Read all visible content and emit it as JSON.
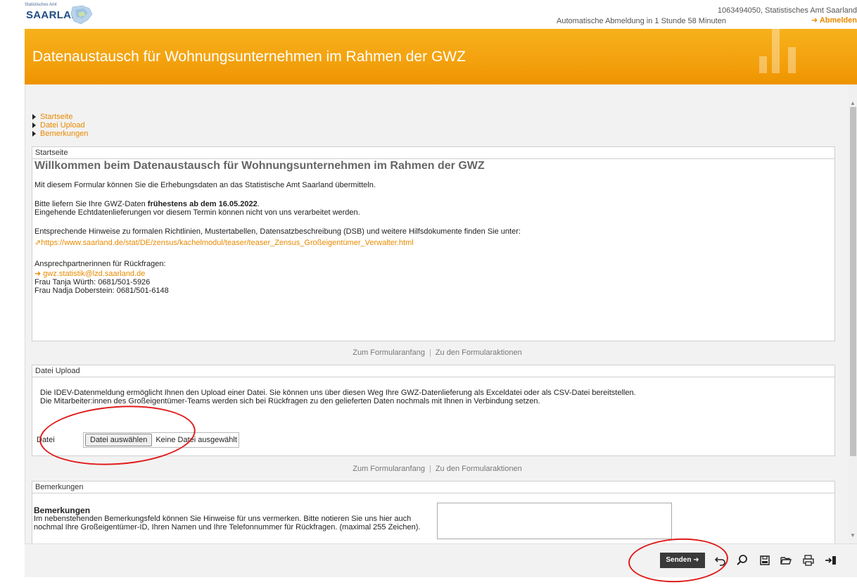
{
  "header": {
    "logo_small": "Statistisches Amt",
    "logo_text": "SAARLAND",
    "auto_logout": "Automatische Abmeldung in 1 Stunde 58 Minuten",
    "user": "1063494050, Statistisches Amt Saarland",
    "logout": "Abmelden"
  },
  "banner": {
    "title": "Datenaustausch für Wohnungsunternehmen im Rahmen der GWZ"
  },
  "nav": [
    {
      "label": "Startseite"
    },
    {
      "label": "Datei Upload"
    },
    {
      "label": "Bemerkungen"
    }
  ],
  "startseite": {
    "header": "Startseite",
    "title": "Willkommen beim Datenaustausch für Wohnungsunternehmen im Rahmen der GWZ",
    "intro": "Mit diesem Formular können Sie die Erhebungsdaten an das Statistische Amt Saarland übermitteln.",
    "deliver_prefix": "Bitte liefern Sie Ihre GWZ-Daten ",
    "deliver_bold": "frühestens ab dem 16.05.2022",
    "deliver_suffix": ".",
    "deliver_note": "Eingehende Echtdatenlieferungen vor diesem Termin können nicht von uns verarbeitet werden.",
    "hints": "Entsprechende Hinweise zu formalen Richtlinien, Mustertabellen, Datensatzbeschreibung (DSB) und weitere Hilfsdokumente finden Sie unter:",
    "hints_link": "https://www.saarland.de/stat/DE/zensus/kachelmodul/teaser/teaser_Zensus_Großeigentümer_Verwalter.html",
    "contact_label": "Ansprechpartnerinnen für Rückfragen:",
    "contact_email": "gwz.statistik@lzd.saarland.de",
    "contact_1": "Frau Tanja Würth: 0681/501-5926",
    "contact_2": "Frau Nadja Doberstein: 0681/501-6148"
  },
  "form_links": {
    "top": "Zum Formularanfang",
    "actions": "Zu den Formularaktionen"
  },
  "upload": {
    "header": "Datei Upload",
    "text_1": "Die IDEV-Datenmeldung ermöglicht Ihnen den Upload einer Datei. Sie können uns über diesen Weg Ihre GWZ-Datenlieferung als Exceldatei oder als CSV-Datei bereitstellen.",
    "text_2": "Die Mitarbeiter:innen des Großeigentümer-Teams werden sich bei Rückfragen zu den gelieferten Daten nochmals mit Ihnen in Verbindung setzen.",
    "file_label": "Datei",
    "choose_button": "Datei auswählen",
    "no_file": "Keine Datei ausgewählt"
  },
  "bemerkungen": {
    "header": "Bemerkungen",
    "title": "Bemerkungen",
    "text": "Im nebenstehenden Bemerkungsfeld können Sie Hinweise für uns vermerken. Bitte notieren Sie uns hier auch nochmal Ihre Großeigentümer-ID, Ihren Namen und Ihre Telefonnummer für Rückfragen. (maximal 255 Zeichen)."
  },
  "footer": {
    "send": "Senden",
    "icons": [
      "undo-icon",
      "search-icon",
      "save-icon",
      "folder-open-icon",
      "print-icon",
      "exit-icon"
    ]
  },
  "colors": {
    "accent": "#e88a00",
    "banner": "#f3a10d",
    "annotation": "#e01b1b"
  }
}
